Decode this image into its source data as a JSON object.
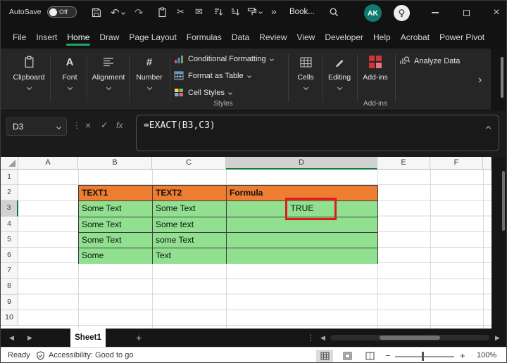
{
  "titlebar": {
    "autosave_label": "AutoSave",
    "autosave_state": "Off",
    "title": "Book...",
    "avatar_initials": "AK"
  },
  "menu": {
    "items": [
      "File",
      "Insert",
      "Home",
      "Draw",
      "Page Layout",
      "Formulas",
      "Data",
      "Review",
      "View",
      "Developer",
      "Help",
      "Acrobat",
      "Power Pivot"
    ],
    "active_item": "Home"
  },
  "ribbon": {
    "clipboard_label": "Clipboard",
    "font_label": "Font",
    "alignment_label": "Alignment",
    "number_label": "Number",
    "styles_items": [
      "Conditional Formatting",
      "Format as Table",
      "Cell Styles"
    ],
    "styles_group_label": "Styles",
    "cells_label": "Cells",
    "editing_label": "Editing",
    "addins_button_label": "Add-ins",
    "addins_group_label": "Add-ins",
    "analyze_data_label": "Analyze Data"
  },
  "formula_bar": {
    "name_box": "D3",
    "fx_label": "fx",
    "formula": "=EXACT(B3,C3)"
  },
  "grid": {
    "column_headers": [
      "A",
      "B",
      "C",
      "D",
      "E",
      "F"
    ],
    "row_headers": [
      "1",
      "2",
      "3",
      "4",
      "5",
      "6",
      "7",
      "8",
      "9",
      "10"
    ],
    "selected_cell": "D3",
    "table": {
      "header_row": [
        "TEXT1",
        "TEXT2",
        "Formula"
      ],
      "rows": [
        [
          "Some Text",
          "Some Text",
          "TRUE"
        ],
        [
          "Some Text",
          "Some text",
          ""
        ],
        [
          "Some Text",
          "some Text",
          ""
        ],
        [
          "Some",
          "Text",
          ""
        ]
      ]
    }
  },
  "sheet_tabs": {
    "active_tab": "Sheet1"
  },
  "status_bar": {
    "mode": "Ready",
    "accessibility": "Accessibility: Good to go",
    "zoom_level": "100%"
  },
  "colors": {
    "accent_green": "#21A366",
    "table_header_fill": "#ED7D31",
    "table_body_fill": "#90E090",
    "annotation_red": "#E01B1B",
    "addins_red": "#D13438",
    "avatar_teal": "#0F7B6F"
  }
}
